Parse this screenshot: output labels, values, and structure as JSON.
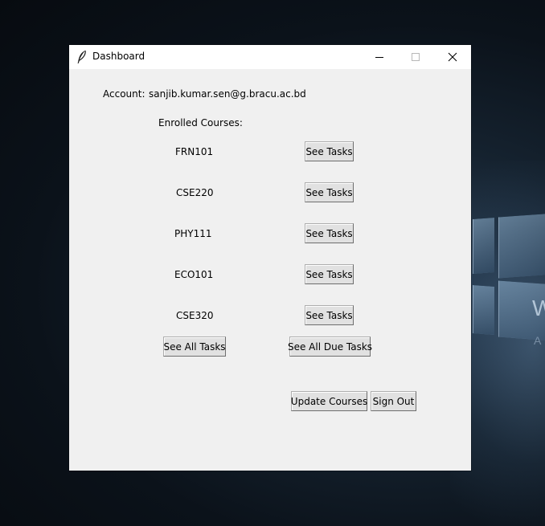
{
  "window": {
    "title": "Dashboard"
  },
  "account": {
    "label": "Account:",
    "email": "sanjib.kumar.sen@g.bracu.ac.bd"
  },
  "courses": {
    "heading": "Enrolled Courses:",
    "see_tasks_label": "See Tasks",
    "items": [
      {
        "code": "FRN101",
        "button_label": "See Tasks"
      },
      {
        "code": "CSE220",
        "button_label": "See Tasks"
      },
      {
        "code": "PHY111",
        "button_label": "See Tasks"
      },
      {
        "code": "ECO101",
        "button_label": "See Tasks"
      },
      {
        "code": "CSE320",
        "button_label": "See Tasks"
      }
    ]
  },
  "actions": {
    "see_all_tasks": "See All Tasks",
    "see_all_due_tasks": "See All Due Tasks",
    "update_courses": "Update Courses",
    "sign_out": "Sign Out"
  },
  "wallpaper": {
    "text_large": "W",
    "text_small": "A"
  }
}
